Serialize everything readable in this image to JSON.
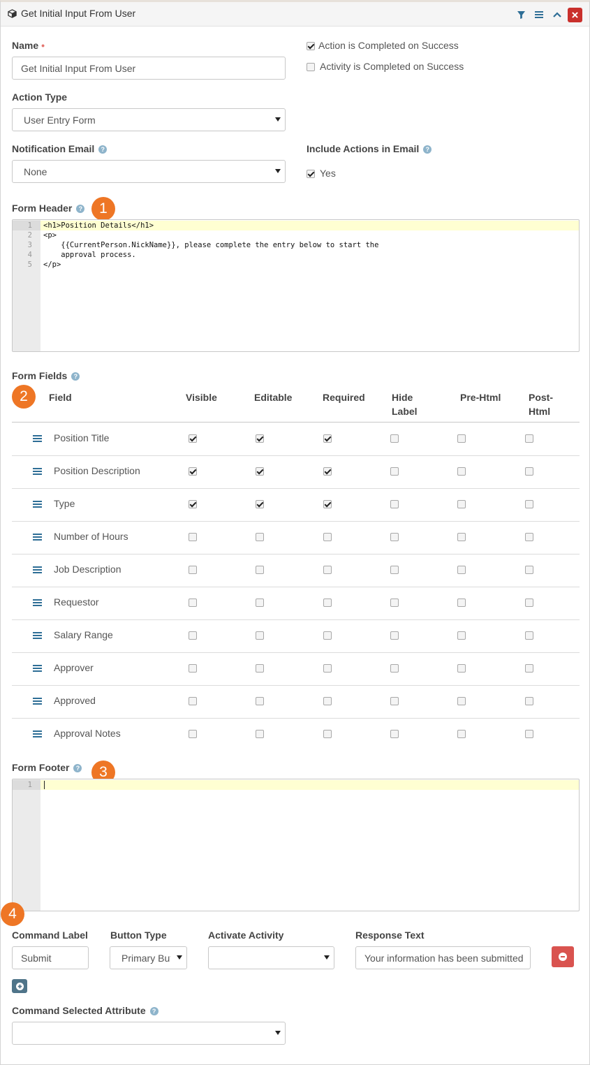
{
  "header": {
    "title": "Get Initial Input From User",
    "icon": "cube-icon",
    "actions": [
      "filter-icon",
      "menu-icon",
      "chevron-up-icon",
      "close-icon"
    ]
  },
  "name": {
    "label": "Name",
    "value": "Get Initial Input From User"
  },
  "options": {
    "action_completed_label": "Action is Completed on Success",
    "action_completed_checked": true,
    "activity_completed_label": "Activity is Completed on Success",
    "activity_completed_checked": false
  },
  "action_type": {
    "label": "Action Type",
    "value": "User Entry Form"
  },
  "notification_email": {
    "label": "Notification Email",
    "value": "None"
  },
  "include_actions": {
    "label": "Include Actions in Email",
    "yes_label": "Yes",
    "yes_checked": true
  },
  "form_header": {
    "label": "Form Header",
    "badge": "1",
    "lines": [
      {
        "n": "1",
        "text": "<h1>Position Details</h1>"
      },
      {
        "n": "2",
        "text": "<p>"
      },
      {
        "n": "3",
        "text": "    {{CurrentPerson.NickName}}, please complete the entry below to start the"
      },
      {
        "n": "4",
        "text": "    approval process."
      },
      {
        "n": "5",
        "text": "</p>"
      }
    ]
  },
  "form_fields": {
    "label": "Form Fields",
    "badge": "2",
    "columns": {
      "field": "Field",
      "visible": "Visible",
      "editable": "Editable",
      "required": "Required",
      "hide_label_1": "Hide",
      "hide_label_2": "Label",
      "pre_html": "Pre-Html",
      "post_html_1": "Post-",
      "post_html_2": "Html"
    },
    "rows": [
      {
        "name": "Position Title",
        "visible": true,
        "editable": true,
        "required": true,
        "hide_label": false,
        "pre_html": false,
        "post_html": false
      },
      {
        "name": "Position Description",
        "visible": true,
        "editable": true,
        "required": true,
        "hide_label": false,
        "pre_html": false,
        "post_html": false
      },
      {
        "name": "Type",
        "visible": true,
        "editable": true,
        "required": true,
        "hide_label": false,
        "pre_html": false,
        "post_html": false
      },
      {
        "name": "Number of Hours",
        "visible": false,
        "editable": false,
        "required": false,
        "hide_label": false,
        "pre_html": false,
        "post_html": false
      },
      {
        "name": "Job Description",
        "visible": false,
        "editable": false,
        "required": false,
        "hide_label": false,
        "pre_html": false,
        "post_html": false
      },
      {
        "name": "Requestor",
        "visible": false,
        "editable": false,
        "required": false,
        "hide_label": false,
        "pre_html": false,
        "post_html": false
      },
      {
        "name": "Salary Range",
        "visible": false,
        "editable": false,
        "required": false,
        "hide_label": false,
        "pre_html": false,
        "post_html": false
      },
      {
        "name": "Approver",
        "visible": false,
        "editable": false,
        "required": false,
        "hide_label": false,
        "pre_html": false,
        "post_html": false
      },
      {
        "name": "Approved",
        "visible": false,
        "editable": false,
        "required": false,
        "hide_label": false,
        "pre_html": false,
        "post_html": false
      },
      {
        "name": "Approval Notes",
        "visible": false,
        "editable": false,
        "required": false,
        "hide_label": false,
        "pre_html": false,
        "post_html": false
      }
    ]
  },
  "form_footer": {
    "label": "Form Footer",
    "badge": "3",
    "lines": [
      {
        "n": "1",
        "text": ""
      }
    ]
  },
  "commands": {
    "badge": "4",
    "command_label_header": "Command Label",
    "button_type_header": "Button Type",
    "activate_activity_header": "Activate Activity",
    "response_text_header": "Response Text",
    "command_label_value": "Submit",
    "button_type_value": "Primary Button",
    "activate_activity_value": "",
    "response_text_value": "Your information has been submitted"
  },
  "command_selected_attribute": {
    "label": "Command Selected Attribute",
    "value": ""
  },
  "colors": {
    "accent_orange": "#ee7625",
    "danger_red": "#d9534f",
    "link_blue": "#2e6e96"
  }
}
